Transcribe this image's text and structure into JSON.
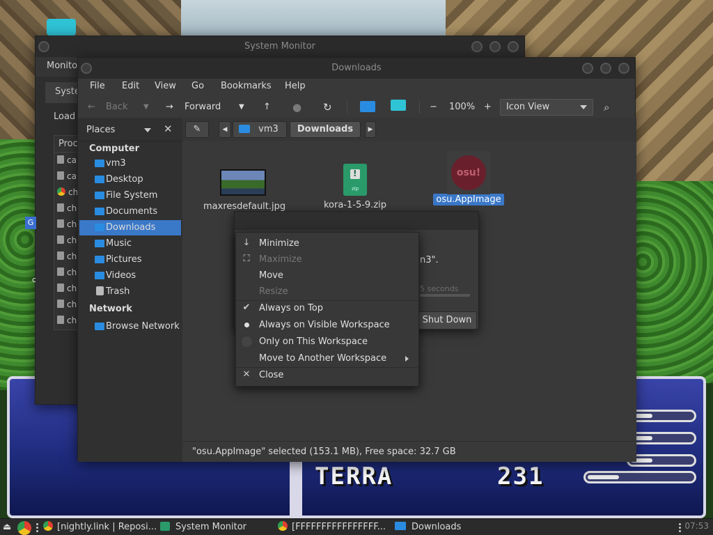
{
  "taskbar": {
    "items": [
      {
        "label": "[nightly.link | Reposi..."
      },
      {
        "label": "System Monitor"
      },
      {
        "label": "[FFFFFFFFFFFFFFFF..."
      },
      {
        "label": "Downloads"
      }
    ],
    "clock": "07:53"
  },
  "game": {
    "name": "TERRA",
    "hp": "231",
    "hp_fill": [
      0.35,
      0.35,
      0.35,
      0.3
    ]
  },
  "sysmon": {
    "title": "System Monitor",
    "menu": "Monito",
    "tab": "Syste",
    "load_label": "Load a",
    "proc_header": "Proc",
    "proc_rows": [
      {
        "text": "ca",
        "icon": "app-icon"
      },
      {
        "text": "ca",
        "icon": "app-icon"
      },
      {
        "text": "ch",
        "icon": "chrome-icon"
      },
      {
        "text": "ch",
        "icon": "app-icon"
      },
      {
        "text": "ch",
        "icon": "app-icon"
      },
      {
        "text": "ch",
        "icon": "app-icon"
      },
      {
        "text": "ch",
        "icon": "app-icon"
      },
      {
        "text": "ch",
        "icon": "app-icon"
      },
      {
        "text": "ch",
        "icon": "app-icon"
      },
      {
        "text": "ch",
        "icon": "app-icon"
      },
      {
        "text": "ch",
        "icon": "app-icon"
      }
    ],
    "badge": "G",
    "c_letter": "c"
  },
  "fm": {
    "title": "Downloads",
    "menu": [
      "File",
      "Edit",
      "View",
      "Go",
      "Bookmarks",
      "Help"
    ],
    "toolbar": {
      "back": "Back",
      "forward": "Forward",
      "zoom": "100%",
      "zoom_minus": "−",
      "zoom_plus": "+",
      "view_mode": "Icon View"
    },
    "sidebar": {
      "header": "Places",
      "sections": {
        "computer": "Computer",
        "network": "Network"
      },
      "computer_items": [
        "vm3",
        "Desktop",
        "File System",
        "Documents",
        "Downloads",
        "Music",
        "Pictures",
        "Videos",
        "Trash"
      ],
      "network_items": [
        "Browse Network"
      ],
      "selected": "Downloads"
    },
    "path": {
      "crumb1": "vm3",
      "crumb2": "Downloads"
    },
    "files": [
      {
        "name": "maxresdefault.jpg"
      },
      {
        "name": "kora-1-5-9.zip",
        "badge": "!",
        "ext": "zip"
      },
      {
        "name": "osu.AppImage",
        "logo": "osu!"
      }
    ],
    "status": "\"osu.AppImage\" selected (153.1 MB), Free space: 32.7 GB"
  },
  "dialog": {
    "message": "n3\".",
    "seconds": "5 seconds",
    "button": "Shut Down"
  },
  "context_menu": {
    "items": [
      {
        "label": "Minimize",
        "icon": "arrow-down-icon",
        "enabled": true
      },
      {
        "label": "Maximize",
        "icon": "maximize-icon",
        "enabled": false
      },
      {
        "label": "Move",
        "enabled": true
      },
      {
        "label": "Resize",
        "enabled": false
      },
      {
        "label": "Always on Top",
        "icon": "check-icon",
        "enabled": true
      },
      {
        "label": "Always on Visible Workspace",
        "icon": "radio-selected-icon",
        "enabled": true
      },
      {
        "label": "Only on This Workspace",
        "icon": "radio-empty-icon",
        "enabled": true
      },
      {
        "label": "Move to Another Workspace",
        "icon": "submenu-arrow-icon",
        "enabled": true
      },
      {
        "label": "Close",
        "icon": "close-icon",
        "enabled": true
      }
    ]
  }
}
